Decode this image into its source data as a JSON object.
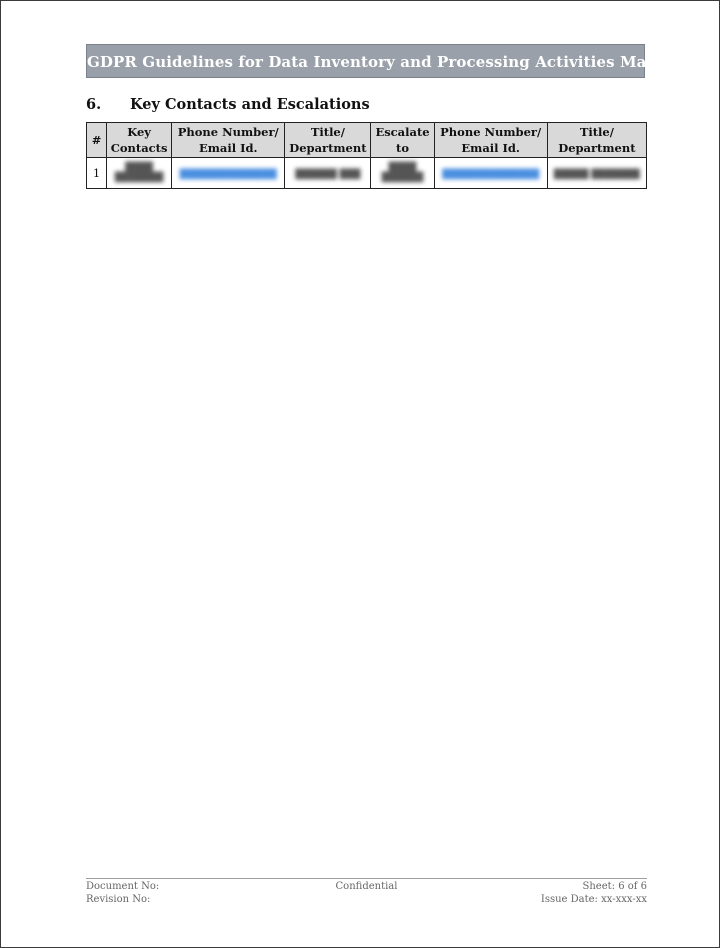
{
  "document": {
    "banner_title": "GDPR Guidelines for Data Inventory and Processing Activities Mapping",
    "section": {
      "number": "6.",
      "title": "Key Contacts and Escalations"
    },
    "table": {
      "headers": [
        "#",
        "Key Contacts",
        "Phone Number/ Email Id.",
        "Title/ Department",
        "Escalate to",
        "Phone Number/ Email Id.",
        "Title/ Department"
      ],
      "header_lines": [
        [
          "#"
        ],
        [
          "Key",
          "Contacts"
        ],
        [
          "Phone Number/",
          "Email Id."
        ],
        [
          "Title/",
          "Department"
        ],
        [
          "Escalate",
          "to"
        ],
        [
          "Phone Number/",
          "Email Id."
        ],
        [
          "Title/",
          "Department"
        ]
      ],
      "rows": [
        {
          "index": "1",
          "key_contact": "[redacted]",
          "contact_email": "[redacted]",
          "contact_title": "[redacted]",
          "escalate_to": "[redacted]",
          "escalate_email": "[redacted]",
          "escalate_title": "[redacted]"
        }
      ]
    }
  },
  "footer": {
    "document_no_label": "Document No:",
    "revision_no_label": "Revision No:",
    "classification": "Confidential",
    "sheet": "Sheet: 6 of 6",
    "issue_date": "Issue Date: xx-xxx-xx"
  },
  "colors": {
    "banner_bg": "#9aa0a9",
    "header_cell_bg": "#d9d9d9",
    "link_blue": "#4a8fe0"
  }
}
